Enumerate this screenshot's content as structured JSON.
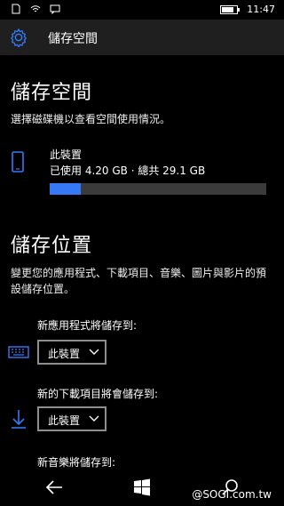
{
  "status_bar": {
    "time": "11:47",
    "battery_level": 0.8
  },
  "header": {
    "title": "儲存空間"
  },
  "storage": {
    "title": "儲存空間",
    "description": "選擇磁碟機以查看空間使用情況。",
    "drive": {
      "name": "此裝置",
      "usage": "已使用 4.20 GB · 總共 29.1 GB",
      "used_gb": 4.2,
      "total_gb": 29.1
    }
  },
  "locations": {
    "title": "儲存位置",
    "description": "變更您的應用程式、下載項目、音樂、圖片與影片的預設儲存位置。",
    "rows": [
      {
        "label": "新應用程式將儲存到:",
        "value": "此裝置",
        "icon": "keyboard-icon"
      },
      {
        "label": "新的下載項目將會儲存到:",
        "value": "此裝置",
        "icon": "download-icon"
      },
      {
        "label": "新音樂將儲存到:"
      }
    ]
  },
  "watermark": "@SOGI.com.tw",
  "colors": {
    "accent": "#3579f6",
    "header_bg": "#1f1f1f",
    "bg": "#000000"
  }
}
